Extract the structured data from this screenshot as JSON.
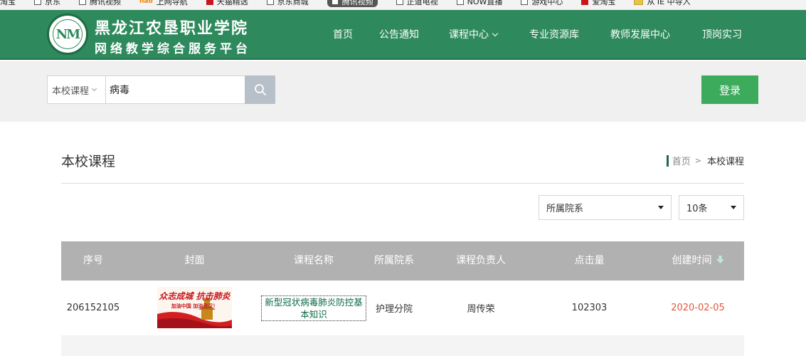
{
  "bookmarks": [
    {
      "label": "淘宝",
      "icon": "none"
    },
    {
      "label": "京东",
      "icon": "page-icon"
    },
    {
      "label": "腾讯视频",
      "icon": "page-icon"
    },
    {
      "label": "上网导航",
      "icon": "hao-icon"
    },
    {
      "label": "天猫精选",
      "icon": "tmall-icon"
    },
    {
      "label": "京东商城",
      "icon": "page-icon"
    },
    {
      "label": "腾讯视频",
      "icon": "page-icon",
      "active": true
    },
    {
      "label": "正道电视",
      "icon": "page-icon"
    },
    {
      "label": "NOW直播",
      "icon": "page-icon"
    },
    {
      "label": "游戏中心",
      "icon": "page-icon"
    },
    {
      "label": "爱淘宝",
      "icon": "aitaobao-icon"
    },
    {
      "label": "从 IE 中导入",
      "icon": "folder-icon"
    }
  ],
  "header": {
    "logo_text": "NM",
    "school_name": "黑龙江农垦职业学院",
    "platform_name": "网络教学综合服务平台",
    "nav": [
      {
        "label": "首页",
        "has_dropdown": false
      },
      {
        "label": "公告通知",
        "has_dropdown": false
      },
      {
        "label": "课程中心",
        "has_dropdown": true
      },
      {
        "label": "专业资源库",
        "has_dropdown": false
      },
      {
        "label": "教师发展中心",
        "has_dropdown": false
      },
      {
        "label": "顶岗实习",
        "has_dropdown": false
      }
    ]
  },
  "search": {
    "scope": "本校课程",
    "query": "病毒",
    "icon": "search-icon"
  },
  "login_label": "登录",
  "page": {
    "title": "本校课程",
    "breadcrumb": {
      "home": "首页",
      "separator": ">",
      "current": "本校课程"
    }
  },
  "filters": {
    "department": "所属院系",
    "page_size": "10条"
  },
  "table": {
    "columns": [
      "序号",
      "封面",
      "课程名称",
      "所属院系",
      "课程负责人",
      "点击量",
      "创建时间"
    ],
    "sort_column": "创建时间",
    "rows": [
      {
        "id": "206152105",
        "cover_text_1": "众志成城 抗击肺炎",
        "cover_text_2": "加油中国 加油武汉！",
        "course_name": "新型冠状病毒肺炎防控基本知识",
        "department": "护理分院",
        "owner": "周传荣",
        "clicks": "102303",
        "created": "2020-02-05"
      }
    ]
  },
  "colors": {
    "header_green": "#2e8a5c",
    "login_green": "#3cab5c",
    "table_header": "#b1b1b1",
    "date_red": "#e5573b",
    "link_green": "#0d6b47"
  }
}
